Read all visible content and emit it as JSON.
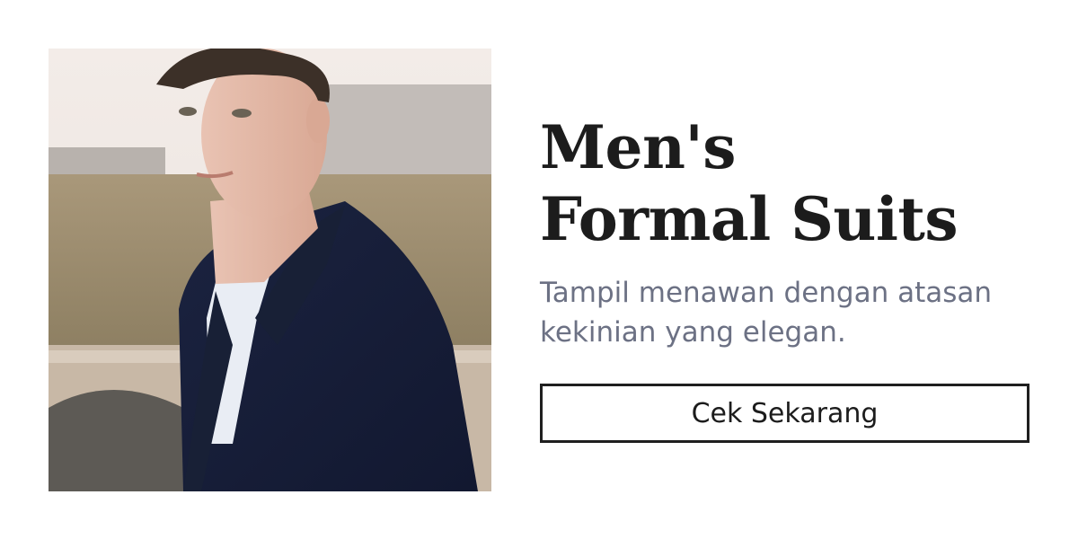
{
  "banner": {
    "image_alt": "Man wearing a navy formal suit",
    "title": "Men's Formal Suits",
    "subtitle": "Tampil menawan dengan atasan kekinian yang elegan.",
    "cta_label": "Cek Sekarang"
  },
  "colors": {
    "title": "#1c1c1c",
    "subtitle": "#6c7184",
    "button_border": "#1f1f1f",
    "background": "#ffffff"
  }
}
